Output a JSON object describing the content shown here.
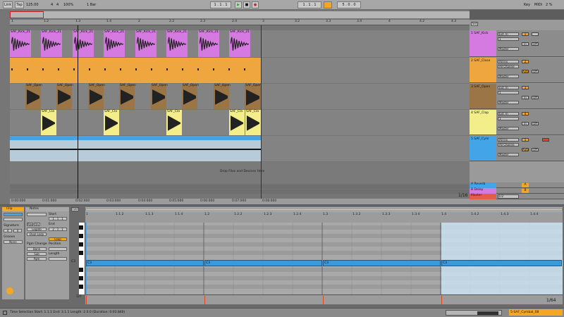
{
  "transport": {
    "link": "Link",
    "tap": "Tap",
    "tempo": "125.00",
    "sig_num": "4",
    "sig_den": "4",
    "zoom": "100%",
    "quant": "1 Bar",
    "position": "1 . 1 . 1",
    "loop_start": "1 . 1 . 1",
    "loop_length": "5 . 0 . 0",
    "key": "Key",
    "midi": "MIDI",
    "cpu": "2 %"
  },
  "arrangement": {
    "bar_ticks": [
      "1",
      "1.2",
      "1.3",
      "1.4",
      "2",
      "2.2",
      "2.3",
      "2.4",
      "3",
      "3.2",
      "3.3",
      "3.4",
      "4",
      "4.2",
      "4.3",
      "4.4",
      "5",
      "5.2",
      "5.3",
      "5.4",
      "6",
      "6.2",
      "6.3",
      "6.4"
    ],
    "time_ticks": [
      "0:00:000",
      "0:01:000",
      "0:02:000",
      "0:03:000",
      "0:04:000",
      "0:05:000",
      "0:06:000",
      "0:07:000",
      "0:08:000"
    ],
    "drop_text": "Drop Files and Devices Here",
    "zoom_ratio": "1/16",
    "tracks": [
      {
        "name": "1 SAF_Kick",
        "clip_label": "SAF_Kick_21",
        "color": "#d57ae0",
        "input": "Ext. In",
        "routing": "1",
        "out": "Master",
        "number": "1"
      },
      {
        "name": "2 SAF_Close",
        "clip_label": "",
        "color": "#f0a63f",
        "input": "All Ins",
        "routing": "All Channe",
        "out": "Master",
        "number": "2"
      },
      {
        "name": "3 SAF_Open",
        "clip_label": "SAF_Open",
        "color": "#9b7545",
        "input": "Ext. In",
        "routing": "1",
        "out": "Master",
        "number": "3"
      },
      {
        "name": "4 SAF_Clap",
        "clip_label": "SAF_Cla",
        "color": "#f3ee8a",
        "input": "Ext. In",
        "routing": "1",
        "out": "Master",
        "number": "4"
      },
      {
        "name": "5 SAF_Cym",
        "clip_label": "",
        "color": "#43a5e8",
        "input": "All Ins",
        "routing": "All Channe",
        "out": "Master",
        "number": "5"
      }
    ],
    "returns": [
      {
        "name": "A Reverb",
        "color": "#43a5e8",
        "number": "A"
      },
      {
        "name": "B Delay",
        "color": "#d57ae0",
        "number": "B"
      },
      {
        "name": "Master",
        "color": "#e85b4a",
        "number": "",
        "ratio": "1/2"
      }
    ],
    "mixer_labels": {
      "auto": "Auto",
      "off": "Off",
      "in": "In",
      "set": "Set"
    }
  },
  "detail": {
    "clip_header": "Clip",
    "notes_header": "Notes",
    "signature": "Signature",
    "sig_num": "4",
    "sig_den": "4",
    "groove": "Groove",
    "groove_value": "None",
    "start": "Start",
    "end": "End",
    "start_val": "1 . 1 . 1",
    "end_val": "2 . 1 . 1",
    "rev": "Rev",
    "inv": "Inv",
    "legato": "Legato",
    "dupl_loop": "Dupl.Loop",
    "loop": "Loop",
    "pgm_change": "Pgm Change",
    "position": "Position",
    "length": "Length",
    "bank": "Bank",
    "sub": "Sub",
    "pgm": "Pgm",
    "fold": "Fold",
    "c3": "C3",
    "zoom_ratio": "1/64",
    "ruler_ticks": [
      "1",
      "1.1.2",
      "1.1.3",
      "1.1.4",
      "1.2",
      "1.2.2",
      "1.2.3",
      "1.2.4",
      "1.3",
      "1.3.2",
      "1.3.3",
      "1.3.4",
      "1.4",
      "1.4.2",
      "1.4.3",
      "1.4.4"
    ],
    "notes": [
      {
        "label": "C3"
      },
      {
        "label": "C3"
      },
      {
        "label": "C3"
      },
      {
        "label": "C3"
      }
    ],
    "vel_max": "127"
  },
  "status": {
    "text": "Time Selection   Start: 1.1.1   End: 3.1.1   Length: 2.0.0  (Duration: 0:03.840)",
    "track": "5-SAF_Cymbal_08"
  }
}
